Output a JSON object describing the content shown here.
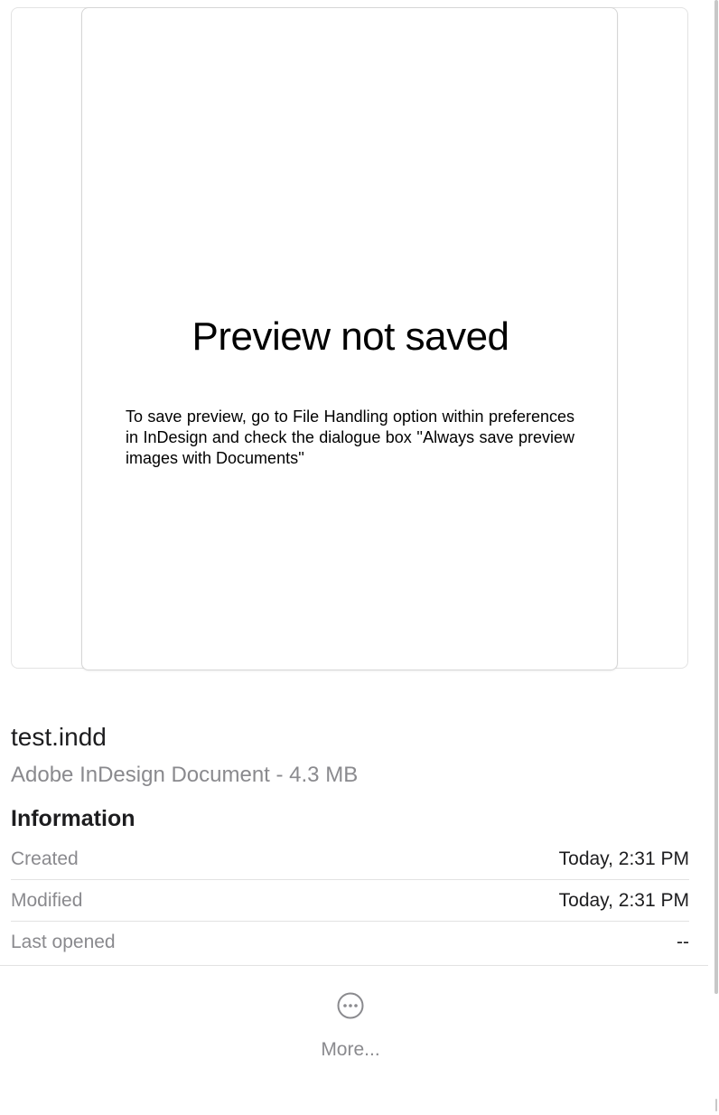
{
  "preview": {
    "title": "Preview not saved",
    "message": "To save preview, go to File Handling option within preferences in InDesign and check the dialogue box ''Always save preview images with Documents''"
  },
  "file": {
    "name": "test.indd",
    "kind_and_size": "Adobe InDesign Document - 4.3 MB"
  },
  "information": {
    "heading": "Information",
    "rows": [
      {
        "label": "Created",
        "value": "Today, 2:31 PM"
      },
      {
        "label": "Modified",
        "value": "Today, 2:31 PM"
      },
      {
        "label": "Last opened",
        "value": "--"
      }
    ]
  },
  "more": {
    "label": "More...",
    "icon": "ellipsis-circle-icon"
  },
  "colors": {
    "secondary_text": "#8a8a8e",
    "primary_text": "#1d1d1f",
    "divider": "#e2e2e2"
  }
}
